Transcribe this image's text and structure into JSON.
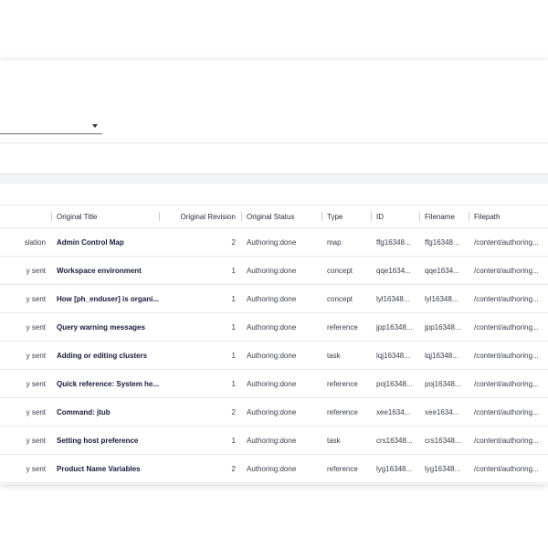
{
  "table": {
    "columns": [
      "",
      "Original Title",
      "Original Revision",
      "Original Status",
      "Type",
      "ID",
      "Filename",
      "Filepath"
    ],
    "rows": [
      [
        "slation",
        "Admin Control Map",
        "2",
        "Authoring:done",
        "map",
        "ffg16348...",
        "ffg16348...",
        "/content/authoring..."
      ],
      [
        "y sent",
        "Workspace environment",
        "1",
        "Authoring:done",
        "concept",
        "qqe1634...",
        "qqe1634...",
        "/content/authoring..."
      ],
      [
        "y sent",
        "How [ph_enduser] is organi...",
        "1",
        "Authoring:done",
        "concept",
        "lyl16348...",
        "lyl16348...",
        "/content/authoring..."
      ],
      [
        "y sent",
        "Query warning messages",
        "1",
        "Authoring:done",
        "reference",
        "jpp16348...",
        "jpp16348...",
        "/content/authoring..."
      ],
      [
        "y sent",
        "Adding or editing clusters",
        "1",
        "Authoring:done",
        "task",
        "lqj16348...",
        "lqj16348...",
        "/content/authoring..."
      ],
      [
        "y sent",
        "Quick reference: System he...",
        "1",
        "Authoring:done",
        "reference",
        "poj16348...",
        "poj16348...",
        "/content/authoring..."
      ],
      [
        "y sent",
        "Command: jtub",
        "2",
        "Authoring:done",
        "reference",
        "xee1634...",
        "xee1634...",
        "/content/authoring..."
      ],
      [
        "y sent",
        "Setting host preference",
        "1",
        "Authoring:done",
        "task",
        "crs16348...",
        "crs16348...",
        "/content/authoring..."
      ],
      [
        "y sent",
        "Product Name Variables",
        "2",
        "Authoring:done",
        "reference",
        "lyg16348...",
        "lyg16348...",
        "/content/authoring..."
      ]
    ]
  },
  "icons": {
    "dropdown": "chevron-down-icon"
  }
}
